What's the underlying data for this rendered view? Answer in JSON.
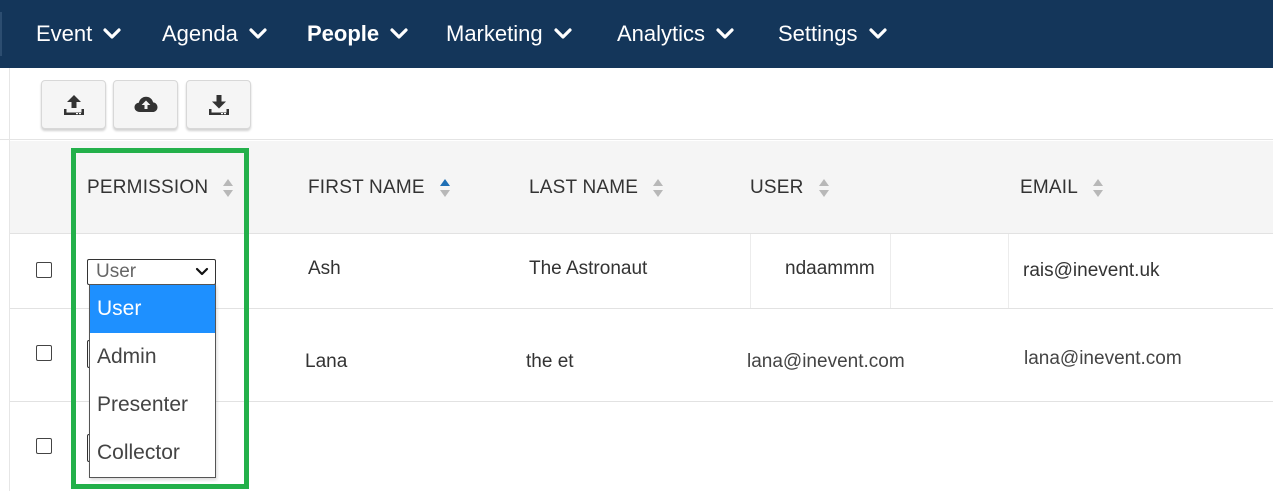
{
  "nav": {
    "items": [
      {
        "label": "Event",
        "active": false
      },
      {
        "label": "Agenda",
        "active": false
      },
      {
        "label": "People",
        "active": true
      },
      {
        "label": "Marketing",
        "active": false
      },
      {
        "label": "Analytics",
        "active": false
      },
      {
        "label": "Settings",
        "active": false
      }
    ]
  },
  "toolbar": {
    "buttons": [
      {
        "icon": "upload-icon"
      },
      {
        "icon": "cloud-upload-icon"
      },
      {
        "icon": "download-icon"
      }
    ]
  },
  "table": {
    "columns": [
      "PERMISSION",
      "FIRST NAME",
      "LAST NAME",
      "USER",
      "EMAIL"
    ],
    "sorted_column": "FIRST NAME",
    "rows": [
      {
        "permission": "User",
        "first_name": "Ash",
        "last_name": "The Astronaut",
        "user": "ndaammm",
        "email": "rais@inevent.uk"
      },
      {
        "permission": "",
        "first_name": "Lana",
        "last_name": "the et",
        "user": "lana@inevent.com",
        "email": "lana@inevent.com"
      },
      {
        "permission": "",
        "first_name": "",
        "last_name": "",
        "user": "",
        "email": ""
      }
    ]
  },
  "permission_dropdown": {
    "options": [
      "User",
      "Admin",
      "Presenter",
      "Collector"
    ],
    "selected": "User"
  },
  "colors": {
    "nav_bg": "#14365a",
    "selected_option": "#1e90ff",
    "highlight": "#23b04a",
    "sort_active": "#1f6fb5"
  }
}
